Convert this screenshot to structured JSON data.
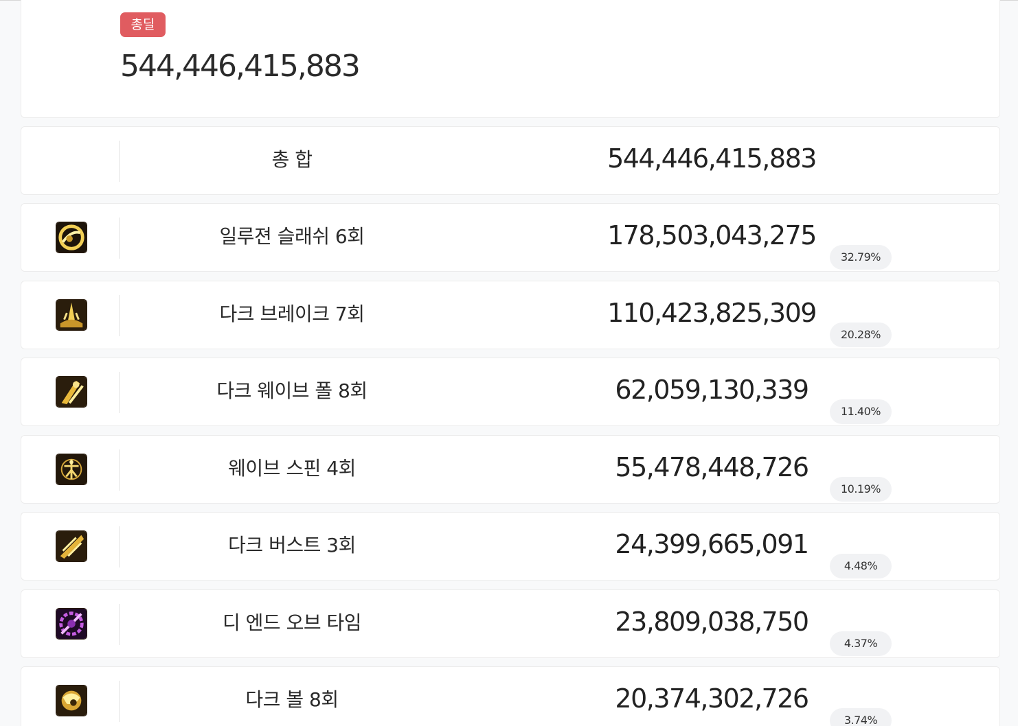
{
  "summary": {
    "badge": "총딜",
    "total_value": "544,446,415,883"
  },
  "total_row": {
    "label": "총 합",
    "value": "544,446,415,883"
  },
  "skills": [
    {
      "name": "일루젼 슬래쉬 6회",
      "value": "178,503,043,275",
      "percent": "32.79%",
      "icon": "illusion-slash-icon"
    },
    {
      "name": "다크 브레이크 7회",
      "value": "110,423,825,309",
      "percent": "20.28%",
      "icon": "dark-break-icon"
    },
    {
      "name": "다크 웨이브 폴 8회",
      "value": "62,059,130,339",
      "percent": "11.40%",
      "icon": "dark-wave-fall-icon"
    },
    {
      "name": "웨이브 스핀 4회",
      "value": "55,478,448,726",
      "percent": "10.19%",
      "icon": "wave-spin-icon"
    },
    {
      "name": "다크 버스트 3회",
      "value": "24,399,665,091",
      "percent": "4.48%",
      "icon": "dark-burst-icon"
    },
    {
      "name": "디 엔드 오브 타임",
      "value": "23,809,038,750",
      "percent": "4.37%",
      "icon": "end-of-time-icon"
    },
    {
      "name": "다크 볼 8회",
      "value": "20,374,302,726",
      "percent": "3.74%",
      "icon": "dark-ball-icon"
    }
  ],
  "colors": {
    "badge": "#e05c60",
    "accent": "#6b7fa6",
    "icon_gold": "#e8c24a",
    "icon_purple": "#b04fd0"
  }
}
